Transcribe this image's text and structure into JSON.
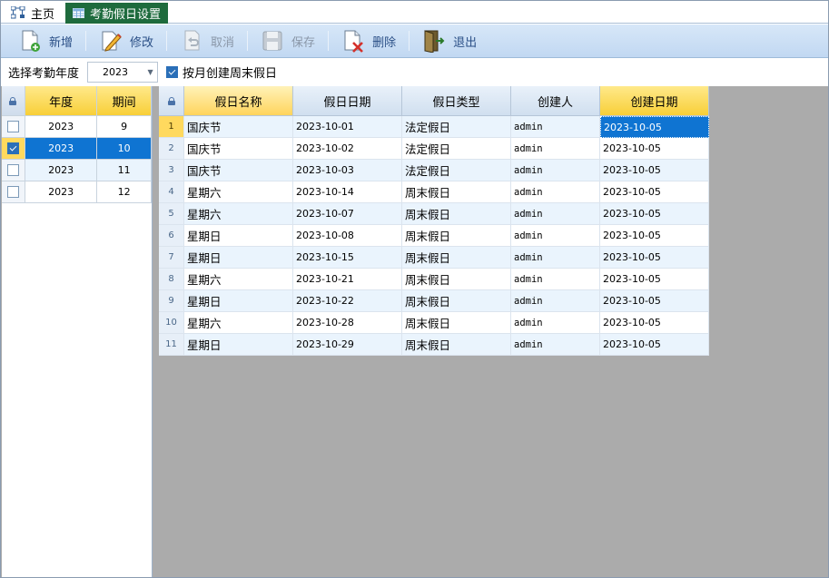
{
  "tabs": {
    "home_label": "主页",
    "active_label": "考勤假日设置"
  },
  "toolbar": {
    "add_label": "新增",
    "edit_label": "修改",
    "cancel_label": "取消",
    "save_label": "保存",
    "delete_label": "删除",
    "exit_label": "退出"
  },
  "filter": {
    "year_label": "选择考勤年度",
    "year_value": "2023",
    "weekend_label": "按月创建周末假日",
    "weekend_checked": true
  },
  "left_grid": {
    "headers": {
      "year": "年度",
      "period": "期间"
    },
    "rows": [
      {
        "year": "2023",
        "period": "9",
        "checked": false
      },
      {
        "year": "2023",
        "period": "10",
        "checked": true
      },
      {
        "year": "2023",
        "period": "11",
        "checked": false
      },
      {
        "year": "2023",
        "period": "12",
        "checked": false
      }
    ]
  },
  "right_grid": {
    "headers": {
      "name": "假日名称",
      "date": "假日日期",
      "type": "假日类型",
      "creator": "创建人",
      "create_date": "创建日期"
    },
    "rows": [
      {
        "num": "1",
        "name": "国庆节",
        "date": "2023-10-01",
        "type": "法定假日",
        "creator": "admin",
        "create_date": "2023-10-05"
      },
      {
        "num": "2",
        "name": "国庆节",
        "date": "2023-10-02",
        "type": "法定假日",
        "creator": "admin",
        "create_date": "2023-10-05"
      },
      {
        "num": "3",
        "name": "国庆节",
        "date": "2023-10-03",
        "type": "法定假日",
        "creator": "admin",
        "create_date": "2023-10-05"
      },
      {
        "num": "4",
        "name": "星期六",
        "date": "2023-10-14",
        "type": "周末假日",
        "creator": "admin",
        "create_date": "2023-10-05"
      },
      {
        "num": "5",
        "name": "星期六",
        "date": "2023-10-07",
        "type": "周末假日",
        "creator": "admin",
        "create_date": "2023-10-05"
      },
      {
        "num": "6",
        "name": "星期日",
        "date": "2023-10-08",
        "type": "周末假日",
        "creator": "admin",
        "create_date": "2023-10-05"
      },
      {
        "num": "7",
        "name": "星期日",
        "date": "2023-10-15",
        "type": "周末假日",
        "creator": "admin",
        "create_date": "2023-10-05"
      },
      {
        "num": "8",
        "name": "星期六",
        "date": "2023-10-21",
        "type": "周末假日",
        "creator": "admin",
        "create_date": "2023-10-05"
      },
      {
        "num": "9",
        "name": "星期日",
        "date": "2023-10-22",
        "type": "周末假日",
        "creator": "admin",
        "create_date": "2023-10-05"
      },
      {
        "num": "10",
        "name": "星期六",
        "date": "2023-10-28",
        "type": "周末假日",
        "creator": "admin",
        "create_date": "2023-10-05"
      },
      {
        "num": "11",
        "name": "星期日",
        "date": "2023-10-29",
        "type": "周末假日",
        "creator": "admin",
        "create_date": "2023-10-05"
      }
    ]
  }
}
